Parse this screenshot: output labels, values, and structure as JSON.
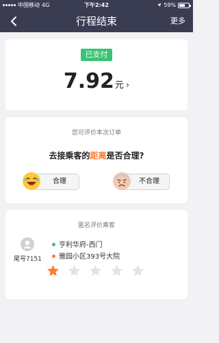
{
  "status_bar": {
    "carrier": "中国移动",
    "network": "4G",
    "time": "下午2:42",
    "battery_text": "59%",
    "battery_level": 0.59
  },
  "nav": {
    "title": "行程结束",
    "more_label": "更多",
    "back_icon": "chevron-left-icon"
  },
  "payment": {
    "status_label": "已支付",
    "amount": "7.92",
    "unit": "元",
    "arrow": "›",
    "badge_color": "#3cc274"
  },
  "rating_prompt": {
    "tip": "您可评价本次订单",
    "question_pre": "去接乘客的",
    "question_highlight": "距离",
    "question_post": "是否合理?",
    "highlight_color": "#ff7a2e",
    "reasonable_label": "合理",
    "unreasonable_label": "不合理"
  },
  "passenger_rating": {
    "title": "匿名评价乘客",
    "tail_label": "尾号7151",
    "from": "亨利华府-西门",
    "to": "雅园小区393号大院",
    "rating": 1,
    "max_rating": 5,
    "star_active_color": "#ff7a2e",
    "star_inactive_color": "#e3e3e3"
  }
}
